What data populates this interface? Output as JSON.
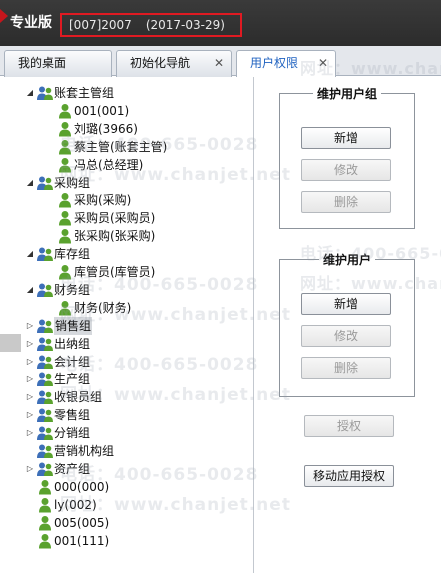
{
  "app": {
    "title": "专业版",
    "account": "[007]2007",
    "date": "(2017-03-29)"
  },
  "tabs": [
    {
      "label": "我的桌面",
      "active": false
    },
    {
      "label": "初始化导航",
      "active": false
    },
    {
      "label": "用户权限",
      "active": true
    }
  ],
  "tree": [
    {
      "label": "账套主管组",
      "type": "group",
      "expanded": true
    },
    {
      "label": "001(001)",
      "type": "user"
    },
    {
      "label": "刘璐(3966)",
      "type": "user"
    },
    {
      "label": "蔡主管(账套主管)",
      "type": "user"
    },
    {
      "label": "冯总(总经理)",
      "type": "user"
    },
    {
      "label": "采购组",
      "type": "group",
      "expanded": true
    },
    {
      "label": "采购(采购)",
      "type": "user"
    },
    {
      "label": "采购员(采购员)",
      "type": "user"
    },
    {
      "label": "张采购(张采购)",
      "type": "user"
    },
    {
      "label": "库存组",
      "type": "group",
      "expanded": true
    },
    {
      "label": "库管员(库管员)",
      "type": "user"
    },
    {
      "label": "财务组",
      "type": "group",
      "expanded": true
    },
    {
      "label": "财务(财务)",
      "type": "user"
    },
    {
      "label": "销售组",
      "type": "group",
      "expanded": false,
      "selected": true
    },
    {
      "label": "出纳组",
      "type": "group",
      "expanded": false
    },
    {
      "label": "会计组",
      "type": "group",
      "expanded": false
    },
    {
      "label": "生产组",
      "type": "group",
      "expanded": false
    },
    {
      "label": "收银员组",
      "type": "group",
      "expanded": false
    },
    {
      "label": "零售组",
      "type": "group",
      "expanded": false
    },
    {
      "label": "分销组",
      "type": "group",
      "expanded": false
    },
    {
      "label": "营销机构组",
      "type": "group",
      "expanded": null
    },
    {
      "label": "资产组",
      "type": "group",
      "expanded": false
    },
    {
      "label": "000(000)",
      "type": "user"
    },
    {
      "label": "ly(002)",
      "type": "user"
    },
    {
      "label": "005(005)",
      "type": "user"
    },
    {
      "label": "001(111)",
      "type": "user"
    }
  ],
  "maintain_group": {
    "title": "维护用户组",
    "add": "新增",
    "edit": "修改",
    "delete": "删除"
  },
  "maintain_user": {
    "title": "维护用户",
    "add": "新增",
    "edit": "修改",
    "delete": "删除"
  },
  "actions": {
    "authorize": "授权",
    "mobile_authorize": "移动应用授权"
  },
  "watermark": {
    "phone": "电话：400-665-0028",
    "site": "网址：www.chanjet.net"
  },
  "colors": {
    "titlebar": "#2f2f2f",
    "accent_red": "#e01a22",
    "tab_active_text": "#1f62c0",
    "group_icon": "#3d6fb8",
    "user_icon": "#5aa22e"
  }
}
